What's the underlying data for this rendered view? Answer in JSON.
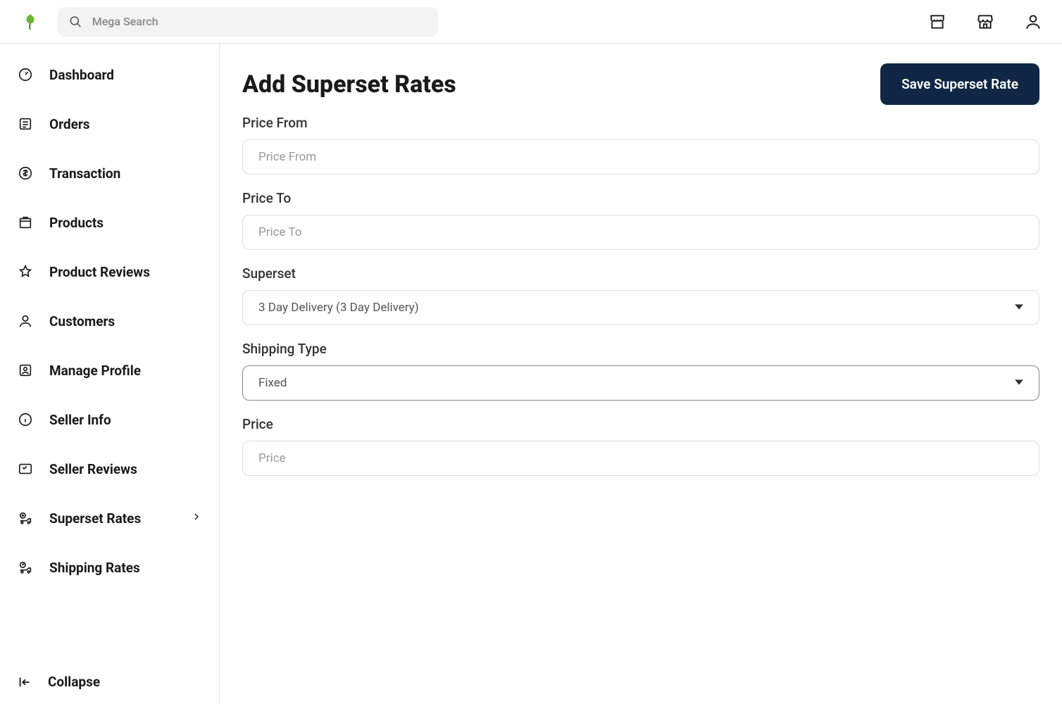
{
  "header": {
    "search_placeholder": "Mega Search"
  },
  "sidebar": {
    "items": [
      {
        "label": "Dashboard"
      },
      {
        "label": "Orders"
      },
      {
        "label": "Transaction"
      },
      {
        "label": "Products"
      },
      {
        "label": "Product Reviews"
      },
      {
        "label": "Customers"
      },
      {
        "label": "Manage Profile"
      },
      {
        "label": "Seller Info"
      },
      {
        "label": "Seller Reviews"
      },
      {
        "label": "Superset Rates"
      },
      {
        "label": "Shipping Rates"
      }
    ],
    "collapse_label": "Collapse"
  },
  "page": {
    "title": "Add Superset Rates",
    "save_button": "Save Superset Rate"
  },
  "form": {
    "price_from": {
      "label": "Price From",
      "placeholder": "Price From",
      "value": ""
    },
    "price_to": {
      "label": "Price To",
      "placeholder": "Price To",
      "value": ""
    },
    "superset": {
      "label": "Superset",
      "selected": "3 Day Delivery (3 Day Delivery)"
    },
    "shipping_type": {
      "label": "Shipping Type",
      "selected": "Fixed"
    },
    "price": {
      "label": "Price",
      "placeholder": "Price",
      "value": ""
    }
  }
}
